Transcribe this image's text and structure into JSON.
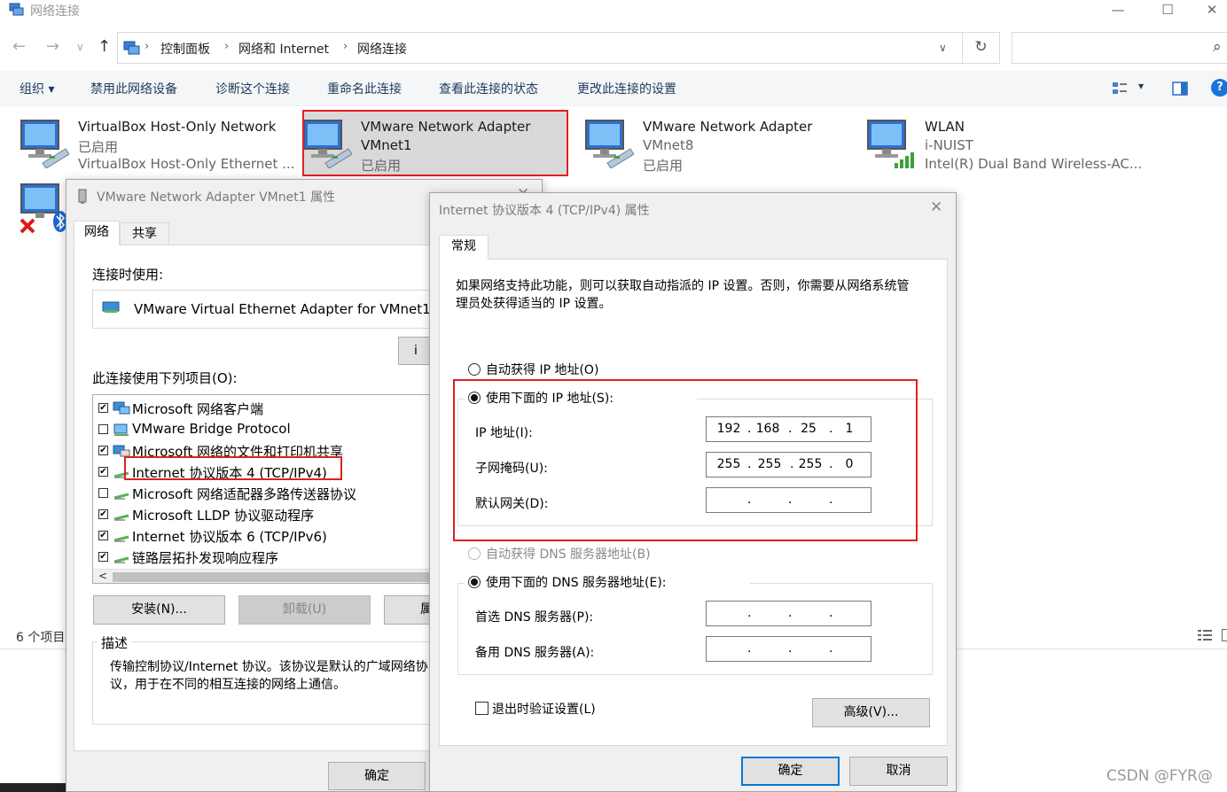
{
  "window": {
    "title": "网络连接",
    "minimize": "—",
    "maximize": "☐",
    "close": "✕"
  },
  "address": {
    "back": "←",
    "forward": "→",
    "recent": "∨",
    "up": "↑",
    "crumbs": [
      "控制面板",
      "网络和 Internet",
      "网络连接"
    ],
    "separator": "›",
    "dropdown": "∨",
    "refresh": "↻",
    "search_icon": "⌕"
  },
  "toolbar": {
    "items": [
      "组织 ▾",
      "禁用此网络设备",
      "诊断这个连接",
      "重命名此连接",
      "查看此连接的状态",
      "更改此连接的设置"
    ],
    "view_menu": "▾",
    "help": "?"
  },
  "connections": [
    {
      "name": "VirtualBox Host-Only Network",
      "status": "已启用",
      "device": "VirtualBox Host-Only Ethernet ..."
    },
    {
      "name": "VMware Network Adapter",
      "status": "VMnet1",
      "device": "已启用"
    },
    {
      "name": "VMware Network Adapter",
      "status": "VMnet8",
      "device": "已启用"
    },
    {
      "name": "WLAN",
      "status": "i-NUIST",
      "device": "Intel(R) Dual Band Wireless-AC..."
    }
  ],
  "status_bar": {
    "count": "6 个项目"
  },
  "props_dialog": {
    "title": "VMware Network Adapter VMnet1 属性",
    "close": "✕",
    "tabs": [
      "网络",
      "共享"
    ],
    "connect_using_label": "连接时使用:",
    "adapter_name": "VMware Virtual Ethernet Adapter for VMnet1",
    "configure_stub": "i",
    "items_label": "此连接使用下列项目(O):",
    "items": [
      {
        "label": "Microsoft 网络客户端",
        "checked": "✔"
      },
      {
        "label": "VMware Bridge Protocol",
        "checked": ""
      },
      {
        "label": "Microsoft 网络的文件和打印机共享",
        "checked": "✔"
      },
      {
        "label": "Internet 协议版本 4 (TCP/IPv4)",
        "checked": "✔"
      },
      {
        "label": "Microsoft 网络适配器多路传送器协议",
        "checked": ""
      },
      {
        "label": "Microsoft LLDP 协议驱动程序",
        "checked": "✔"
      },
      {
        "label": "Internet 协议版本 6 (TCP/IPv6)",
        "checked": "✔"
      },
      {
        "label": "链路层拓扑发现响应程序",
        "checked": "✔"
      }
    ],
    "scroll_left": "<",
    "install_button": "安装(N)...",
    "uninstall_button": "卸载(U)",
    "properties_stub": "属",
    "description_label": "描述",
    "description": "传输控制协议/Internet 协议。该协议是默认的广域网络协议，用于在不同的相互连接的网络上通信。",
    "ok_button": "确定"
  },
  "ipv4_dialog": {
    "title": "Internet 协议版本 4 (TCP/IPv4) 属性",
    "close": "✕",
    "tab": "常规",
    "intro": "如果网络支持此功能，则可以获取自动指派的 IP 设置。否则，你需要从网络系统管理员处获得适当的 IP 设置。",
    "auto_ip": "自动获得 IP 地址(O)",
    "manual_ip": "使用下面的 IP 地址(S):",
    "ip_label": "IP 地址(I):",
    "ip_value": [
      "192",
      "168",
      "25",
      "1"
    ],
    "mask_label": "子网掩码(U):",
    "mask_value": [
      "255",
      "255",
      "255",
      "0"
    ],
    "gateway_label": "默认网关(D):",
    "auto_dns": "自动获得 DNS 服务器地址(B)",
    "manual_dns": "使用下面的 DNS 服务器地址(E):",
    "preferred_dns_label": "首选 DNS 服务器(P):",
    "alternate_dns_label": "备用 DNS 服务器(A):",
    "validate_label": "退出时验证设置(L)",
    "advanced_button": "高级(V)...",
    "ok_button": "确定",
    "cancel_button": "取消",
    "dot": "."
  },
  "watermark": "CSDN @FYR@",
  "colors": {
    "accent": "#0078d7",
    "highlight_red": "#e02020",
    "selected_bg": "#d9d9d9"
  }
}
